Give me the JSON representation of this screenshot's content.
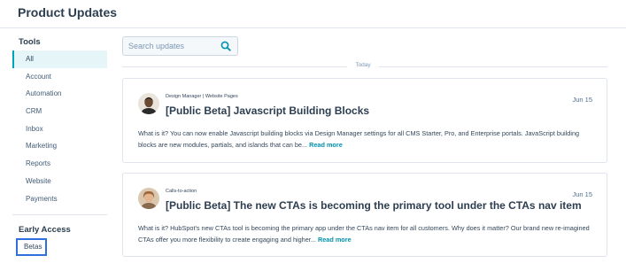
{
  "header": {
    "title": "Product Updates"
  },
  "sidebar": {
    "tools_title": "Tools",
    "items": [
      {
        "label": "All",
        "active": true
      },
      {
        "label": "Account"
      },
      {
        "label": "Automation"
      },
      {
        "label": "CRM"
      },
      {
        "label": "Inbox"
      },
      {
        "label": "Marketing"
      },
      {
        "label": "Reports"
      },
      {
        "label": "Website"
      },
      {
        "label": "Payments"
      }
    ],
    "early_access_title": "Early Access",
    "early_access_items": [
      {
        "label": "Betas"
      }
    ]
  },
  "search": {
    "placeholder": "Search updates",
    "value": "",
    "icon": "search-icon"
  },
  "divider": {
    "label": "Today"
  },
  "updates": [
    {
      "category": "Design Manager | Website Pages",
      "title": "[Public Beta] Javascript Building Blocks",
      "date": "Jun 15",
      "body": "What is it? You can now enable Javascript building blocks via Design Manager settings for all CMS Starter, Pro, and Enterprise portals. JavaScript building blocks are new modules, partials, and islands that can be...",
      "read_more": "Read more"
    },
    {
      "category": "Calls-to-action",
      "title": "[Public Beta] The new CTAs is becoming the primary tool under the CTAs nav item",
      "date": "Jun 15",
      "body": "What is it? HubSpot's new CTAs tool is becoming the primary app under the CTAs nav item for all customers. Why does it matter? Our brand new re-imagined CTAs offer you more flexibility to create engaging and higher...",
      "read_more": "Read more"
    }
  ],
  "colors": {
    "accent": "#00a4bd",
    "active_bg": "#e5f5f8",
    "link": "#0091ae",
    "highlight_border": "#2f6fde"
  }
}
